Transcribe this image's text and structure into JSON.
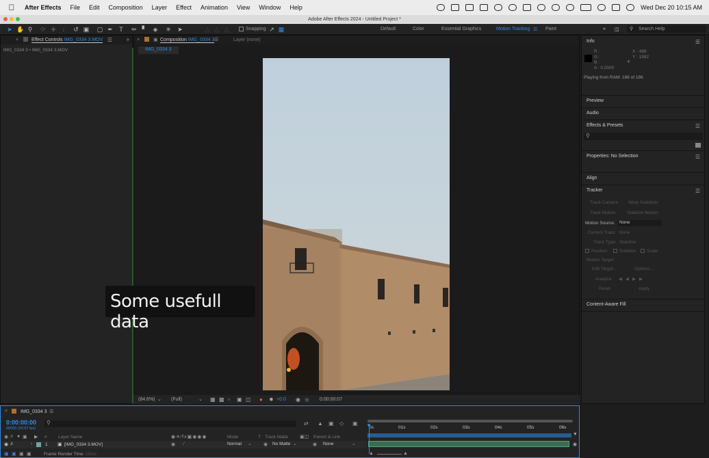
{
  "menubar": {
    "app": "After Effects",
    "items": [
      "File",
      "Edit",
      "Composition",
      "Layer",
      "Effect",
      "Animation",
      "View",
      "Window",
      "Help"
    ],
    "datetime": "Wed Dec 20  10:15 AM"
  },
  "window": {
    "title": "Adobe After Effects 2024 - Untitled Project *"
  },
  "toolbar": {
    "snapping": "Snapping",
    "workspaces": [
      "Default",
      "Color",
      "Essential Graphics",
      "Motion Tracking",
      "Paint"
    ],
    "active_workspace": "Motion Tracking",
    "search_placeholder": "Search Help"
  },
  "effect_controls": {
    "tab_prefix": "Effect Controls",
    "tab_file": "IMG_0334 3.MOV",
    "subtitle": "IMG_0334 3 • IMG_0334 3.MOV"
  },
  "composition": {
    "tab_prefix": "Composition",
    "tab_name": "IMG_0334 3",
    "layer_tab": "Layer (none)",
    "breadcrumb": "IMG_0334 3"
  },
  "overlay": {
    "caption": "Some usefull data"
  },
  "viewer_controls": {
    "zoom": "(84.6%)",
    "resolution": "(Full)",
    "exposure": "+0.0",
    "timecode": "0:00:00:07"
  },
  "info": {
    "title": "Info",
    "r": "R :",
    "g": "G :",
    "b": "B :",
    "a": "A :  0.0000",
    "x": "X :  488",
    "y": "Y :  1982",
    "status": "Playing from RAM: 186 of 186"
  },
  "right_panels": {
    "preview": "Preview",
    "audio": "Audio",
    "effects_presets": "Effects & Presets",
    "properties": "Properties: No Selection",
    "align": "Align",
    "tracker": "Tracker",
    "content_aware": "Content-Aware Fill"
  },
  "tracker": {
    "track_camera": "Track Camera",
    "warp_stabilizer": "Warp Stabilizer",
    "track_motion": "Track Motion",
    "stabilize_motion": "Stabilize Motion",
    "motion_source_label": "Motion Source:",
    "motion_source_value": "None",
    "current_track": "Current Track:",
    "current_track_value": "None",
    "track_type": "Track Type:",
    "track_type_value": "Stabilize",
    "position": "Position",
    "rotation": "Rotation",
    "scale": "Scale",
    "motion_target": "Motion Target:",
    "edit_target": "Edit Target...",
    "options": "Options...",
    "analyze": "Analyze:",
    "reset": "Reset",
    "apply": "Apply"
  },
  "timeline": {
    "comp_tab": "IMG_0334 3",
    "timecode": "0:00:00:00",
    "fps": "00000 (29.97 fps)",
    "col_hash": "#",
    "col_layer": "Layer Name",
    "col_mode": "Mode",
    "col_t": "T",
    "col_matte": "Track Matte",
    "col_parent": "Parent & Link",
    "ruler": [
      "0s",
      "01s",
      "02s",
      "03s",
      "04s",
      "05s",
      "06s"
    ],
    "layer": {
      "index": "1",
      "name": "[IMG_0334 3.MOV]",
      "mode": "Normal",
      "matte": "No Matte",
      "parent": "None"
    },
    "footer": "Frame Render Time",
    "footer_ms": "15ms"
  },
  "colors": {
    "accent": "#2d8ceb",
    "layer_bar": "#3b6b52",
    "panel": "#232323"
  }
}
